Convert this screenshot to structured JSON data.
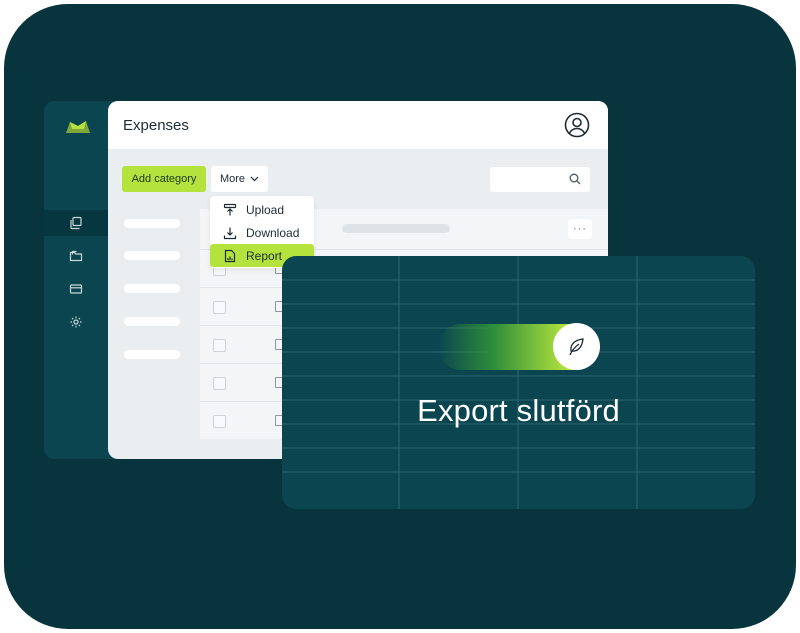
{
  "header": {
    "title": "Expenses"
  },
  "toolbar": {
    "add_label": "Add category",
    "more_label": "More",
    "search_placeholder": ""
  },
  "more_menu": {
    "items": [
      {
        "label": "Upload",
        "icon": "upload-icon"
      },
      {
        "label": "Download",
        "icon": "download-icon"
      },
      {
        "label": "Report",
        "icon": "report-icon",
        "selected": true
      }
    ]
  },
  "sidebar": {
    "items": [
      {
        "icon": "stack-icon",
        "active": true
      },
      {
        "icon": "folder-icon"
      },
      {
        "icon": "card-icon"
      },
      {
        "icon": "gear-icon"
      }
    ]
  },
  "table": {
    "row_menu": "···"
  },
  "export_toast": {
    "message": "Export slutförd",
    "icon": "leaf-icon"
  },
  "colors": {
    "frame": "#07343d",
    "panel_dark": "#0b4550",
    "accent": "#b4e33d",
    "text": "#1d2b33"
  }
}
